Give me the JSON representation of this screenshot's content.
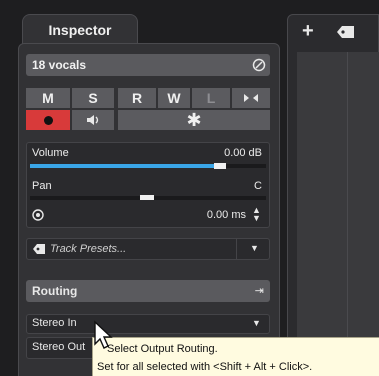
{
  "inspector": {
    "tab_label": "Inspector",
    "track_name": "18 vocals",
    "buttons": {
      "mute": "M",
      "solo": "S",
      "read": "R",
      "write": "W",
      "listen": "L"
    },
    "volume": {
      "label": "Volume",
      "value": "0.00 dB",
      "level": 0.78
    },
    "pan": {
      "label": "Pan",
      "value": "C"
    },
    "delay": {
      "value": "0.00 ms"
    },
    "track_presets": {
      "placeholder": "Track Presets..."
    },
    "routing": {
      "title": "Routing",
      "input": "Stereo In",
      "output": "Stereo Out"
    }
  },
  "toolbar": {
    "add_label": "+"
  },
  "tooltip": {
    "line1": "Select Output Routing.",
    "line2": "Set for all selected with <Shift + Alt + Click>."
  },
  "colors": {
    "record": "#d83a3a",
    "volume_bar": "#3aa6e8",
    "accent": "#3a3a3d"
  }
}
